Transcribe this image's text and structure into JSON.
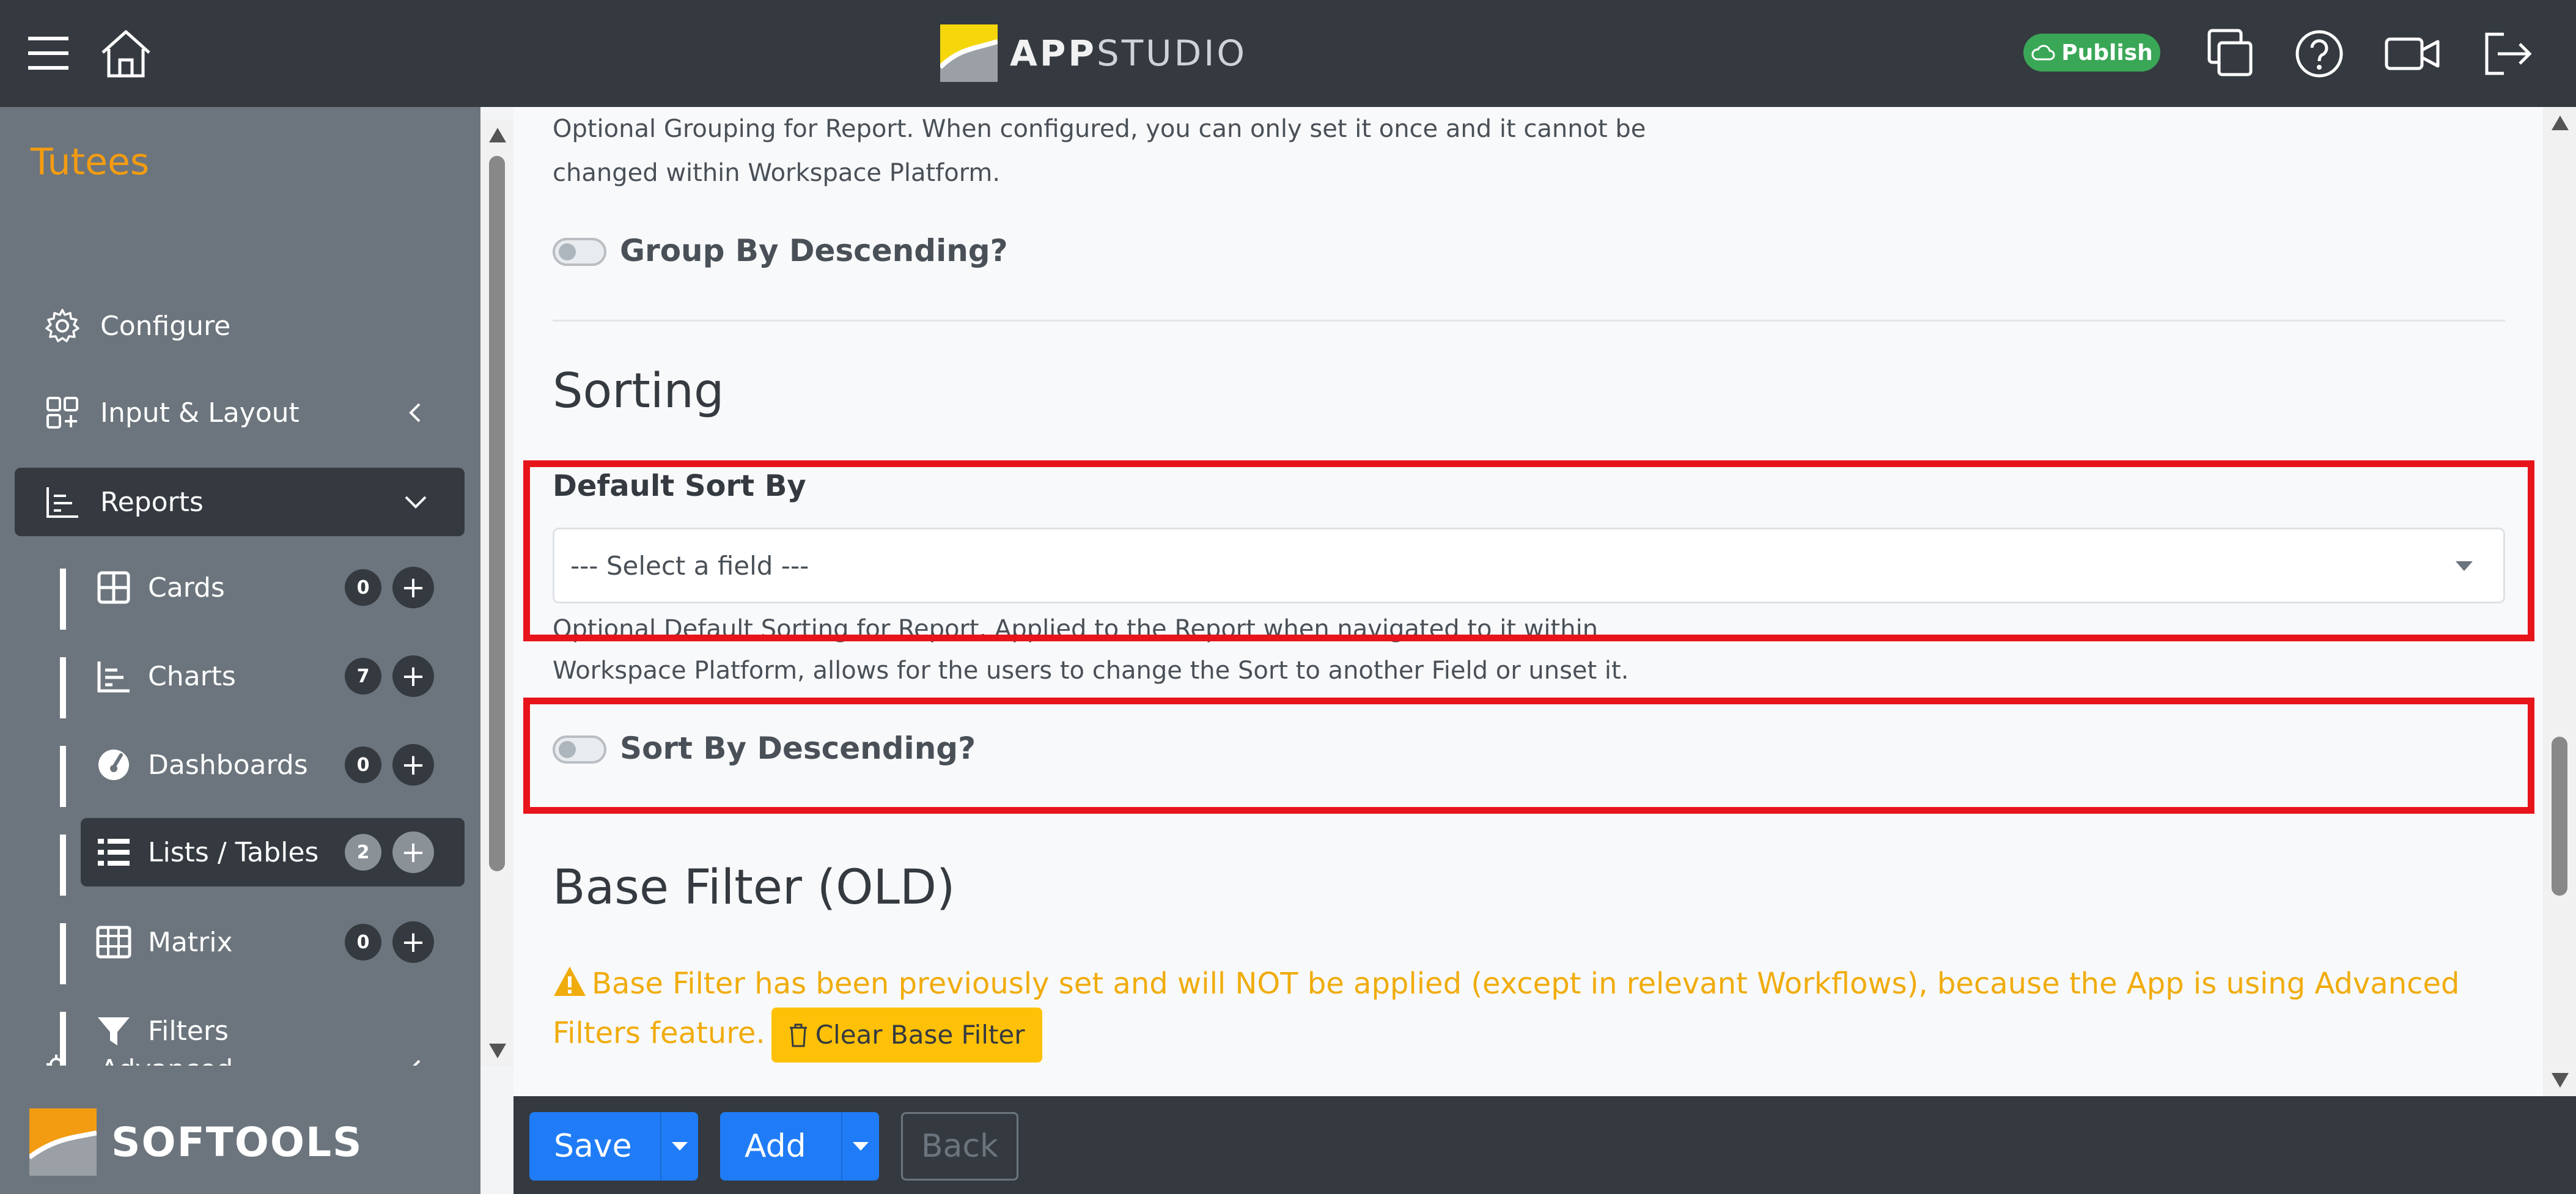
{
  "header": {
    "logo_bold": "APP",
    "logo_thin": "STUDIO",
    "publish_label": "Publish",
    "icons": [
      "menu-icon",
      "home-icon",
      "copy-icon",
      "help-icon",
      "video-icon",
      "logout-icon"
    ],
    "colors": {
      "bar": "#343a40",
      "publish": "#3aa757",
      "logo_yellow": "#f5d60a"
    }
  },
  "sidebar": {
    "app_title": "Tutees",
    "items": [
      {
        "label": "Configure",
        "icon": "gear-icon"
      },
      {
        "label": "Input & Layout",
        "icon": "layout-icon"
      },
      {
        "label": "Reports",
        "icon": "reports-icon",
        "expanded": true
      },
      {
        "label": "Advanced",
        "icon": "advanced-gears-icon"
      }
    ],
    "sub_items": [
      {
        "label": "Cards",
        "count": "0",
        "icon": "cards-grid-icon"
      },
      {
        "label": "Charts",
        "count": "7",
        "icon": "chart-icon"
      },
      {
        "label": "Dashboards",
        "count": "0",
        "icon": "dashboard-gauge-icon"
      },
      {
        "label": "Lists / Tables",
        "count": "2",
        "icon": "list-icon",
        "active": true
      },
      {
        "label": "Matrix",
        "count": "0",
        "icon": "matrix-table-icon"
      },
      {
        "label": "Filters",
        "icon": "filter-icon"
      }
    ],
    "footer_brand": "SOFTOOLS",
    "colors": {
      "background": "#6c757d",
      "active": "#343a40",
      "title": "#f39c12"
    }
  },
  "main": {
    "grouping_help_line1": "Optional Grouping for Report. When configured, you can only set it once and it cannot be",
    "grouping_help_line2": "changed within Workspace Platform.",
    "group_desc_label": "Group By Descending?",
    "sorting_heading": "Sorting",
    "default_sort_label": "Default Sort By",
    "sort_select_value": "--- Select a field ---",
    "sort_help_line1": "Optional Default Sorting for Report. Applied to the Report when navigated to it within",
    "sort_help_line2": "Workspace Platform, allows for the users to change the Sort to another Field or unset it.",
    "sort_desc_label": "Sort By Descending?",
    "base_filter_heading": "Base Filter (OLD)",
    "warning_text": "Base Filter has been previously set and will NOT be applied (except in relevant Workflows), because the App is using Advanced Filters feature.",
    "clear_filter_label": "Clear Base Filter",
    "colors": {
      "highlight": "#e8141b",
      "warning": "#f0ac0c",
      "clear_button": "#ffc107"
    }
  },
  "actions": {
    "save_label": "Save",
    "add_label": "Add",
    "back_label": "Back",
    "colors": {
      "primary": "#1f7cf6"
    }
  }
}
